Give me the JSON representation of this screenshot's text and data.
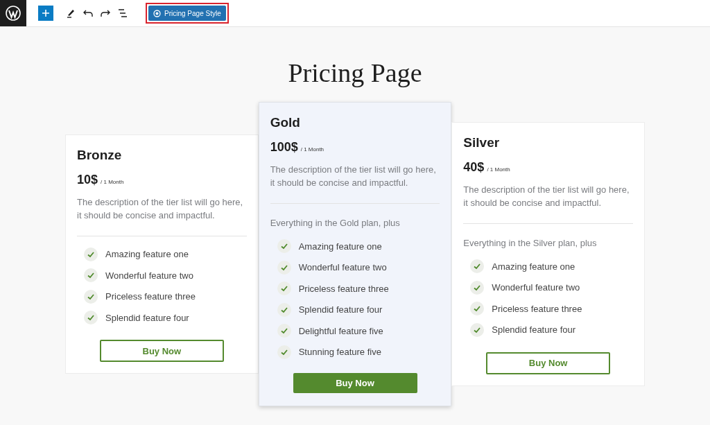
{
  "toolbar": {
    "style_button": {
      "label": "Pricing Page Style",
      "highlighted": true
    }
  },
  "page": {
    "title": "Pricing Page"
  },
  "plans": [
    {
      "name": "Bronze",
      "price": "10$",
      "period": "/ 1 Month",
      "description": "The description of the tier list will go here, it should be concise and impactful.",
      "featured": false,
      "features": [
        "Amazing feature one",
        "Wonderful feature two",
        "Priceless feature three",
        "Splendid feature four"
      ],
      "button": "Buy Now"
    },
    {
      "name": "Gold",
      "price": "100$",
      "period": "/ 1 Month",
      "description": "The description of the tier list will go here, it should be concise and impactful.",
      "featured": true,
      "intro": "Everything in the Gold plan, plus",
      "features": [
        "Amazing feature one",
        "Wonderful feature two",
        "Priceless feature three",
        "Splendid feature four",
        "Delightful feature five",
        "Stunning feature five"
      ],
      "button": "Buy Now"
    },
    {
      "name": "Silver",
      "price": "40$",
      "period": "/ 1 Month",
      "description": "The description of the tier list will go here, it should be concise and impactful.",
      "featured": false,
      "intro": "Everything in the Silver plan, plus",
      "features": [
        "Amazing feature one",
        "Wonderful feature two",
        "Priceless feature three",
        "Splendid feature four"
      ],
      "button": "Buy Now"
    }
  ]
}
